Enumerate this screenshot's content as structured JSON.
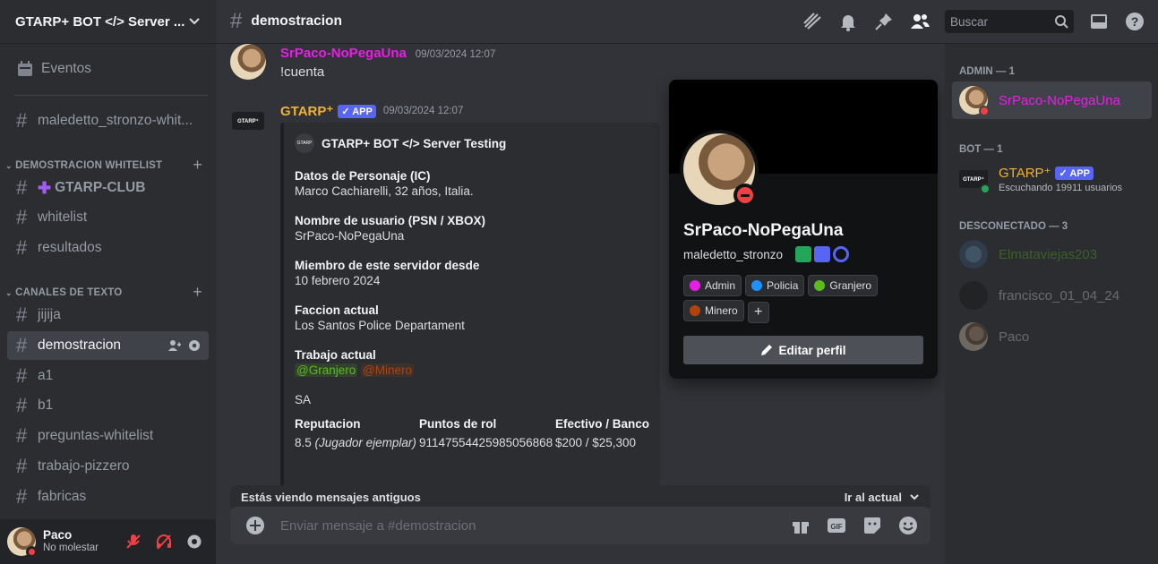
{
  "server": {
    "name": "GTARP+ BOT </> Server ..."
  },
  "sidebar": {
    "events_label": "Eventos",
    "top_channel": "maledetto_stronzo-whit...",
    "categories": [
      {
        "name": "DEMOSTRACION WHITELIST"
      },
      {
        "name": "CANALES DE TEXTO"
      }
    ],
    "channels_cat1": [
      "GTARP-CLUB",
      "whitelist",
      "resultados"
    ],
    "channels_cat2": [
      "jijija",
      "demostracion",
      "a1",
      "b1",
      "preguntas-whitelist",
      "trabajo-pizzero",
      "fabricas"
    ]
  },
  "user_panel": {
    "name": "Paco",
    "status": "No molestar"
  },
  "topbar": {
    "channel": "demostracion",
    "search_placeholder": "Buscar"
  },
  "messages": {
    "m1": {
      "author": "SrPaco-NoPegaUna",
      "time": "09/03/2024 12:07",
      "text": "!cuenta"
    },
    "m2": {
      "author": "GTARP⁺",
      "badge": "APP",
      "time": "09/03/2024 12:07"
    }
  },
  "embed": {
    "header": "GTARP+ BOT </> Server Testing",
    "fields": [
      {
        "name": "Datos de Personaje (IC)",
        "value": "Marco Cachiarelli, 32 años, Italia."
      },
      {
        "name": "Nombre de usuario (PSN / XBOX)",
        "value": "SrPaco-NoPegaUna"
      },
      {
        "name": "Miembro de este servidor desde",
        "value": "10 febrero 2024"
      },
      {
        "name": "Faccion actual",
        "value": "Los Santos Police Departament"
      },
      {
        "name": "Trabajo actual",
        "mention1": "@Granjero",
        "mention2": "@Minero"
      }
    ],
    "sa": "SA",
    "inline": [
      {
        "name": "Reputacion",
        "value": "8.5",
        "extra": "(Jugador ejemplar)"
      },
      {
        "name": "Puntos de rol",
        "value": "9114755442598505686​8"
      },
      {
        "name": "Efectivo / Banco",
        "value": "$200 / $25,300"
      }
    ]
  },
  "old_messages_bar": {
    "text": "Estás viendo mensajes antiguos",
    "jump": "Ir al actual"
  },
  "composer": {
    "placeholder": "Enviar mensaje a #demostracion"
  },
  "popout": {
    "display_name": "SrPaco-NoPegaUna",
    "username": "maledetto_stronzo",
    "roles": [
      {
        "name": "Admin",
        "color": "#e91ee5"
      },
      {
        "name": "Policia",
        "color": "#1e90ff"
      },
      {
        "name": "Granjero",
        "color": "#5bbc1e"
      },
      {
        "name": "Minero",
        "color": "#b0440e"
      }
    ],
    "edit_label": "Editar perfil"
  },
  "members": {
    "admin_header": "ADMIN — 1",
    "admin_name": "SrPaco-NoPegaUna",
    "bot_header": "BOT — 1",
    "bot_name": "GTARP⁺",
    "bot_badge": "APP",
    "bot_activity": "Escuchando 19911 usuarios",
    "offline_header": "DESCONECTADO — 3",
    "offline": [
      "Elmataviejas203",
      "francisco_01_04_24",
      "Paco"
    ]
  },
  "colors": {
    "accent": "#5865f2",
    "admin": "#e91ee5",
    "bot": "#f0b232"
  }
}
